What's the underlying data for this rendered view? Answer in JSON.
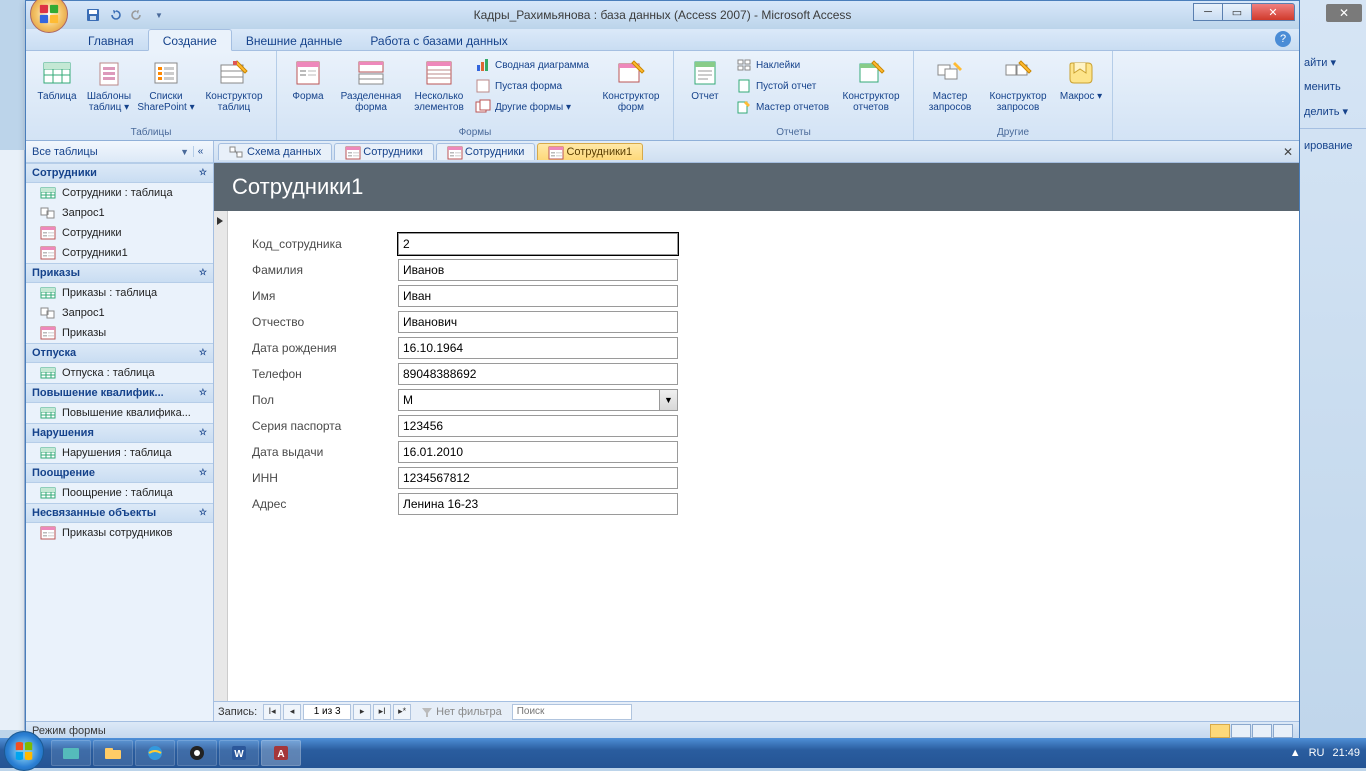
{
  "window": {
    "title": "Кадры_Рахимьянова : база данных (Access 2007) - Microsoft Access"
  },
  "ribbon_tabs": [
    "Главная",
    "Создание",
    "Внешние данные",
    "Работа с базами данных"
  ],
  "ribbon_active_tab": "Создание",
  "ribbon": {
    "groups": [
      {
        "label": "Таблицы",
        "big": [
          "Таблица",
          "Шаблоны таблиц ▾",
          "Списки SharePoint ▾",
          "Конструктор таблиц"
        ]
      },
      {
        "label": "Формы",
        "big": [
          "Форма",
          "Разделенная форма",
          "Несколько элементов"
        ],
        "small": [
          "Сводная диаграмма",
          "Пустая форма",
          "Другие формы ▾"
        ],
        "big2": [
          "Конструктор форм"
        ]
      },
      {
        "label": "Отчеты",
        "big": [
          "Отчет"
        ],
        "small": [
          "Наклейки",
          "Пустой отчет",
          "Мастер отчетов"
        ],
        "big2": [
          "Конструктор отчетов"
        ]
      },
      {
        "label": "Другие",
        "big": [
          "Мастер запросов",
          "Конструктор запросов",
          "Макрос ▾"
        ]
      }
    ]
  },
  "nav": {
    "header": "Все таблицы",
    "groups": [
      {
        "label": "Сотрудники",
        "items": [
          {
            "icon": "table",
            "label": "Сотрудники : таблица"
          },
          {
            "icon": "query",
            "label": "Запрос1"
          },
          {
            "icon": "form",
            "label": "Сотрудники"
          },
          {
            "icon": "form",
            "label": "Сотрудники1"
          }
        ]
      },
      {
        "label": "Приказы",
        "items": [
          {
            "icon": "table",
            "label": "Приказы : таблица"
          },
          {
            "icon": "query",
            "label": "Запрос1"
          },
          {
            "icon": "form",
            "label": "Приказы"
          }
        ]
      },
      {
        "label": "Отпуска",
        "items": [
          {
            "icon": "table",
            "label": "Отпуска : таблица"
          }
        ]
      },
      {
        "label": "Повышение квалифик...",
        "items": [
          {
            "icon": "table",
            "label": "Повышение квалифика..."
          }
        ]
      },
      {
        "label": "Нарушения",
        "items": [
          {
            "icon": "table",
            "label": "Нарушения : таблица"
          }
        ]
      },
      {
        "label": "Поощрение",
        "items": [
          {
            "icon": "table",
            "label": "Поощрение : таблица"
          }
        ]
      },
      {
        "label": "Несвязанные объекты",
        "items": [
          {
            "icon": "form",
            "label": "Приказы сотрудников"
          }
        ]
      }
    ]
  },
  "doc_tabs": [
    {
      "icon": "schema",
      "label": "Схема данных",
      "active": false
    },
    {
      "icon": "form",
      "label": "Сотрудники",
      "active": false
    },
    {
      "icon": "form",
      "label": "Сотрудники",
      "active": false
    },
    {
      "icon": "form",
      "label": "Сотрудники1",
      "active": true
    }
  ],
  "form": {
    "title": "Сотрудники1",
    "fields": [
      {
        "label": "Код_сотрудника",
        "value": "2",
        "type": "text"
      },
      {
        "label": "Фамилия",
        "value": "Иванов",
        "type": "text"
      },
      {
        "label": "Имя",
        "value": "Иван",
        "type": "text"
      },
      {
        "label": "Отчество",
        "value": "Иванович",
        "type": "text"
      },
      {
        "label": "Дата рождения",
        "value": "16.10.1964",
        "type": "text"
      },
      {
        "label": "Телефон",
        "value": "89048388692",
        "type": "text"
      },
      {
        "label": "Пол",
        "value": "М",
        "type": "select"
      },
      {
        "label": "Серия паспорта",
        "value": "123456",
        "type": "text"
      },
      {
        "label": "Дата выдачи",
        "value": "16.01.2010",
        "type": "text"
      },
      {
        "label": "ИНН",
        "value": "1234567812",
        "type": "text"
      },
      {
        "label": "Адрес",
        "value": "Ленина 16-23",
        "type": "text"
      }
    ]
  },
  "record_nav": {
    "label": "Запись:",
    "position": "1 из 3",
    "filter": "Нет фильтра",
    "search": "Поиск"
  },
  "statusbar": {
    "mode": "Режим формы"
  },
  "taskbar": {
    "lang": "RU",
    "time": "21:49"
  },
  "right_strip": [
    "айти ▾",
    "менить",
    "делить ▾",
    "ирование"
  ]
}
